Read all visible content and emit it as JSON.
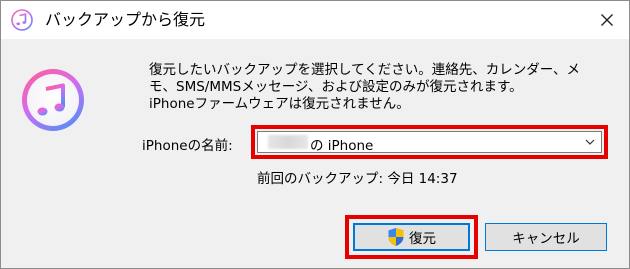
{
  "window": {
    "title": "バックアップから復元"
  },
  "message": {
    "text": "復元したいバックアップを選択してください。連絡先、カレンダー、メ\nモ、SMS/MMSメッセージ、および設定のみが復元されます。\niPhoneファームウェアは復元されません。"
  },
  "device": {
    "label": "iPhoneの名前:",
    "selected_value": "の iPhone",
    "last_backup": "前回のバックアップ: 今日 14:37"
  },
  "buttons": {
    "restore": "復元",
    "cancel": "キャンセル"
  },
  "icons": {
    "title": "itunes-icon",
    "app": "itunes-music-icon",
    "close": "close-icon",
    "dropdown": "chevron-down-icon",
    "restore": "uac-shield-icon"
  },
  "colors": {
    "highlight": "#e60000",
    "focus_border": "#0078d7"
  }
}
